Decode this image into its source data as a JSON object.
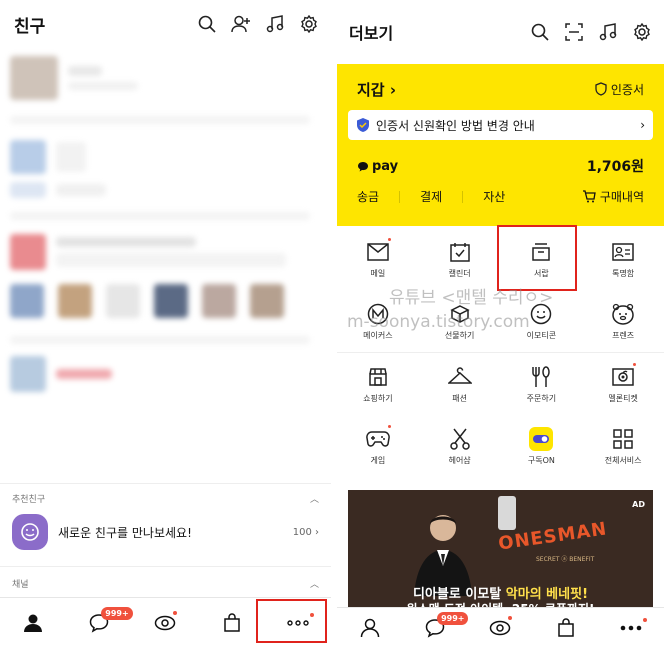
{
  "left": {
    "title": "친구",
    "section_recommend": "추천친구",
    "recommend_text": "새로운 친구를 만나보세요!",
    "recommend_count": "100",
    "section_channel": "채널",
    "badge": "999+"
  },
  "right": {
    "title": "더보기",
    "wallet_title": "지갑",
    "cert_label": "인증서",
    "notice_text": "인증서 신원확인 방법 변경 안내",
    "pay_label": "pay",
    "pay_amount": "1,706원",
    "pay_tabs": [
      "송금",
      "결제",
      "자산"
    ],
    "purchase_label": "구매내역",
    "grid": [
      {
        "label": "메일",
        "icon": "mail-icon",
        "dot": true
      },
      {
        "label": "캘린더",
        "icon": "calendar-icon",
        "dot": false
      },
      {
        "label": "서랍",
        "icon": "drawer-icon",
        "dot": false
      },
      {
        "label": "톡명함",
        "icon": "namecard-icon",
        "dot": false
      },
      {
        "label": "메이커스",
        "icon": "makers-icon",
        "dot": false
      },
      {
        "label": "선물하기",
        "icon": "gift-icon",
        "dot": false
      },
      {
        "label": "이모티콘",
        "icon": "emoticon-icon",
        "dot": false
      },
      {
        "label": "프렌즈",
        "icon": "friends-icon",
        "dot": false
      },
      {
        "label": "쇼핑하기",
        "icon": "shopping-icon",
        "dot": false
      },
      {
        "label": "패션",
        "icon": "fashion-icon",
        "dot": false
      },
      {
        "label": "주문하기",
        "icon": "order-icon",
        "dot": false
      },
      {
        "label": "멜론티켓",
        "icon": "melon-ticket-icon",
        "dot": true
      },
      {
        "label": "게임",
        "icon": "game-icon",
        "dot": true
      },
      {
        "label": "헤어샵",
        "icon": "hairshop-icon",
        "dot": false
      },
      {
        "label": "구독ON",
        "icon": "subscribe-icon",
        "dot": false
      },
      {
        "label": "전체서비스",
        "icon": "all-services-icon",
        "dot": false
      }
    ],
    "watermark_line1": "유튜브 <맨텔 수리ㅇ>",
    "watermark_line2": "m-soonya.tistory.com",
    "banner_ad": "AD",
    "banner_brand": "ONESMAN",
    "banner_sub": "SECRET ⓐ BENEFIT",
    "banner_line1_a": "디아블로 이모탈 ",
    "banner_line1_b": "악마의 베네핏!",
    "banner_line2": "원스맨 도전 아이템, 25% 쿠폰까지!",
    "badge": "999+"
  },
  "colors": {
    "accent": "#fee500",
    "highlight": "#e0231c",
    "badge": "#f0513d"
  }
}
